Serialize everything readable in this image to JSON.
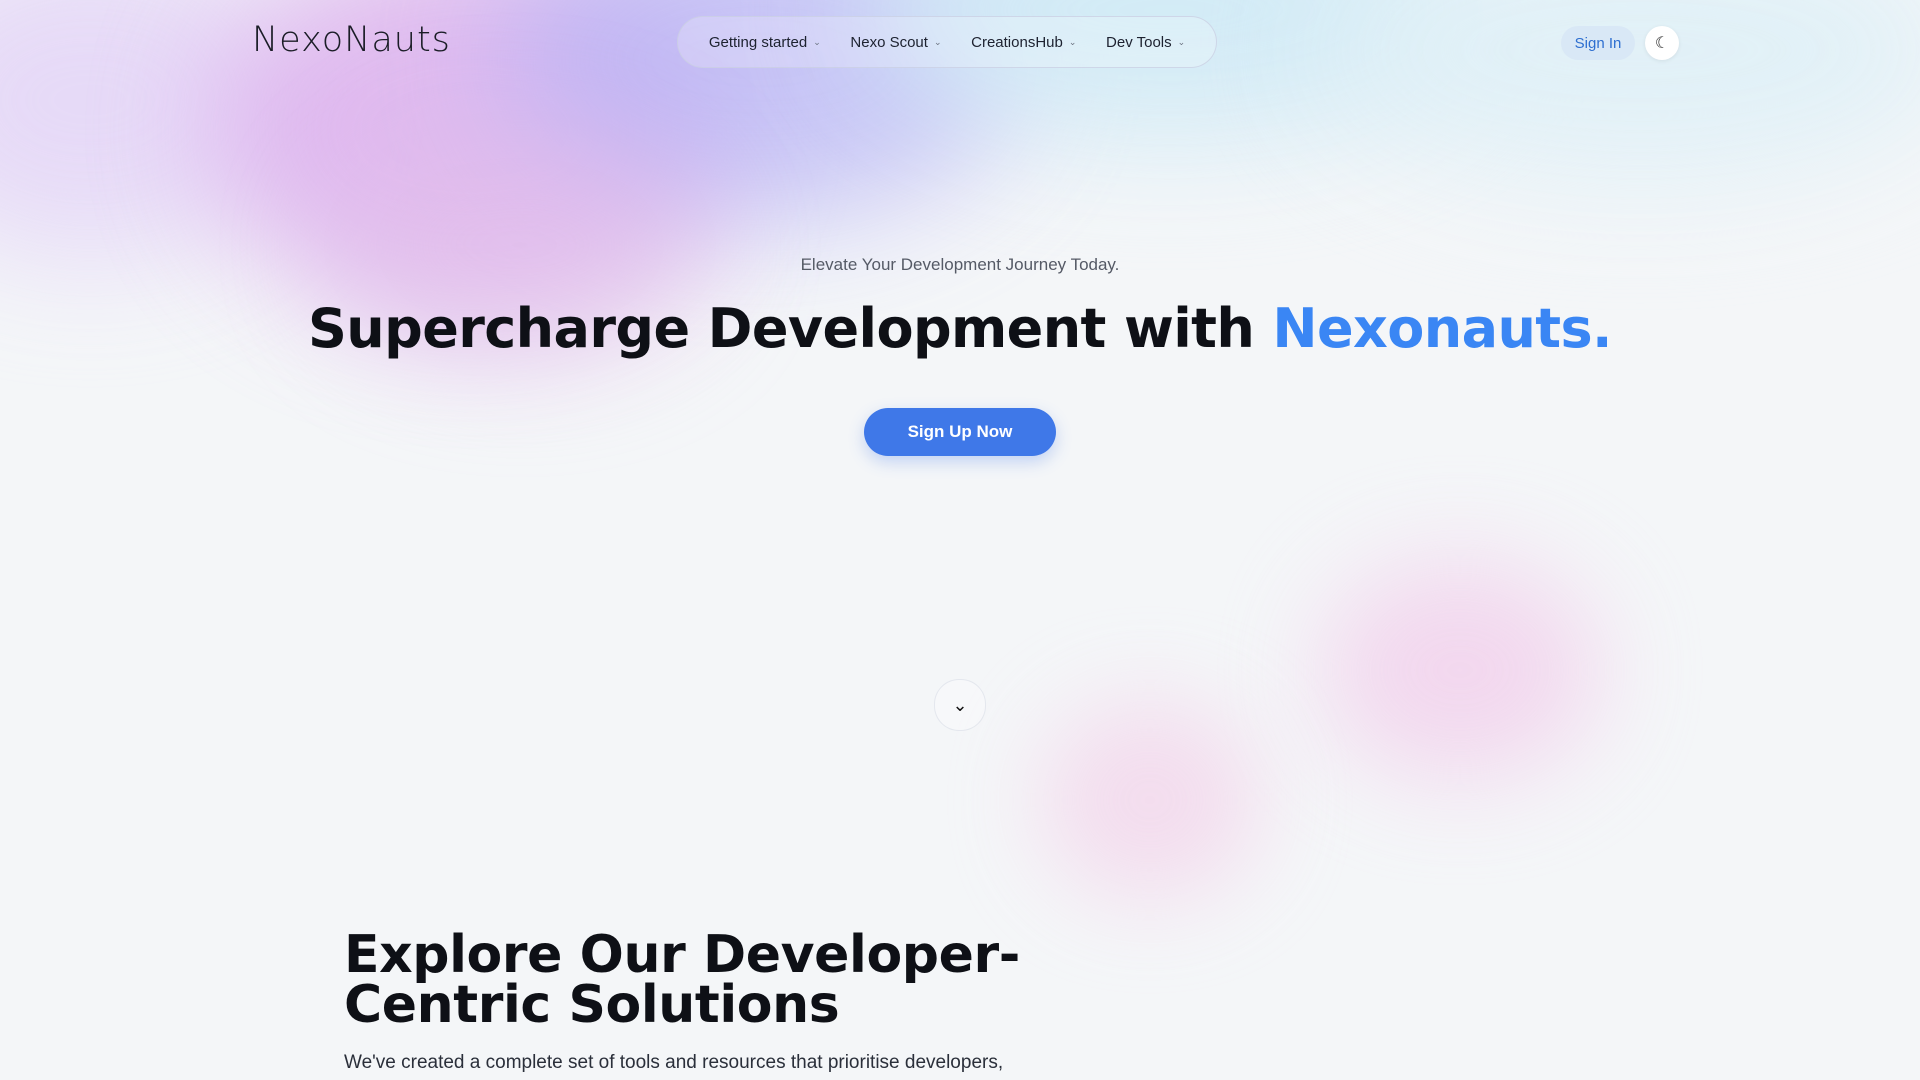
{
  "brand": "NexoNauts",
  "nav": {
    "items": [
      {
        "label": "Getting started"
      },
      {
        "label": "Nexo Scout"
      },
      {
        "label": "CreationsHub"
      },
      {
        "label": "Dev Tools"
      }
    ],
    "signin": "Sign In",
    "theme_icon": "moon-icon"
  },
  "hero": {
    "subtitle": "Elevate Your Development Journey Today.",
    "title_main": "Supercharge Development",
    "title_with": "with",
    "title_accent": "Nexonauts.",
    "cta": "Sign Up Now"
  },
  "scroll_icon": "chevron-down-icon",
  "section": {
    "title_line1": "Explore Our Developer-",
    "title_line2": "Centric Solutions",
    "text": "We've created a complete set of tools and resources that prioritise developers,"
  },
  "colors": {
    "accent": "#3a86f4",
    "button": "#3f78e8",
    "signin_bg": "#d9e8f6"
  }
}
